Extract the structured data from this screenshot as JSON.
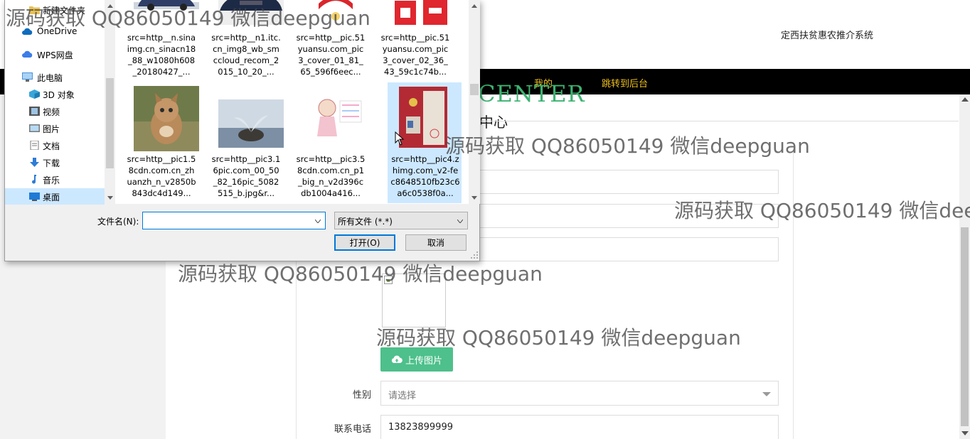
{
  "site": {
    "title": "定西扶贫惠农推介系统",
    "nav": {
      "my": "我的",
      "admin": "跳转到后台",
      "partial": "·"
    },
    "center_letters": "CENTER",
    "center_title": "中心"
  },
  "form": {
    "upload_label": "上传图片",
    "gender": {
      "label": "性别",
      "placeholder": "请选择"
    },
    "phone": {
      "label": "联系电话",
      "value": "13823899999"
    }
  },
  "dialog": {
    "nav_items": [
      {
        "label": "新建文件夹",
        "icon": "folder-icon"
      },
      {
        "label": "OneDrive",
        "icon": "cloud-icon"
      },
      {
        "label": "WPS网盘",
        "icon": "cloud-icon"
      },
      {
        "label": "此电脑",
        "icon": "computer-icon"
      },
      {
        "label": "3D 对象",
        "icon": "cube-icon"
      },
      {
        "label": "视频",
        "icon": "video-icon"
      },
      {
        "label": "图片",
        "icon": "picture-icon"
      },
      {
        "label": "文档",
        "icon": "document-icon"
      },
      {
        "label": "下载",
        "icon": "download-icon"
      },
      {
        "label": "音乐",
        "icon": "music-icon"
      },
      {
        "label": "桌面",
        "icon": "desktop-icon"
      }
    ],
    "files_row1": [
      "src=http__n.sinaimg.cn_sinacn18_88_w1080h608_20180427_...",
      "src=http__n1.itc.cn_img8_wb_smccloud_recom_2015_10_20_...",
      "src=http__pic.51yuansu.com_pic3_cover_01_81_65_596f6eec...",
      "src=http__pic.51yuansu.com_pic3_cover_02_36_43_59c1c74b..."
    ],
    "files_row2": [
      "src=http__pic1.58cdn.com.cn_zhuanzh_n_v2850b843dc4d149...",
      "src=http__pic3.16pic.com_00_50_82_16pic_5082515_b.jpg&r...",
      "src=http__pic3.58cdn.com.cn_p1_big_n_v2d396cdb1004a416...",
      "src=http__pic4.zhimg.com_v2-fec8648510fb23c6a6c0538f0a..."
    ],
    "filename_label": "文件名(N):",
    "filename_value": "",
    "filetype": "所有文件 (*.*)",
    "open_button": "打开(O)",
    "cancel_button": "取消"
  },
  "watermark": "源码获取 QQ86050149 微信deepguan",
  "colors": {
    "nav_bg": "#000000",
    "nav_text": "#f0c020",
    "upload_btn": "#4ec08b",
    "center_green": "#3cb371",
    "dialog_select": "#cce8ff",
    "dialog_accent": "#0078d7"
  }
}
